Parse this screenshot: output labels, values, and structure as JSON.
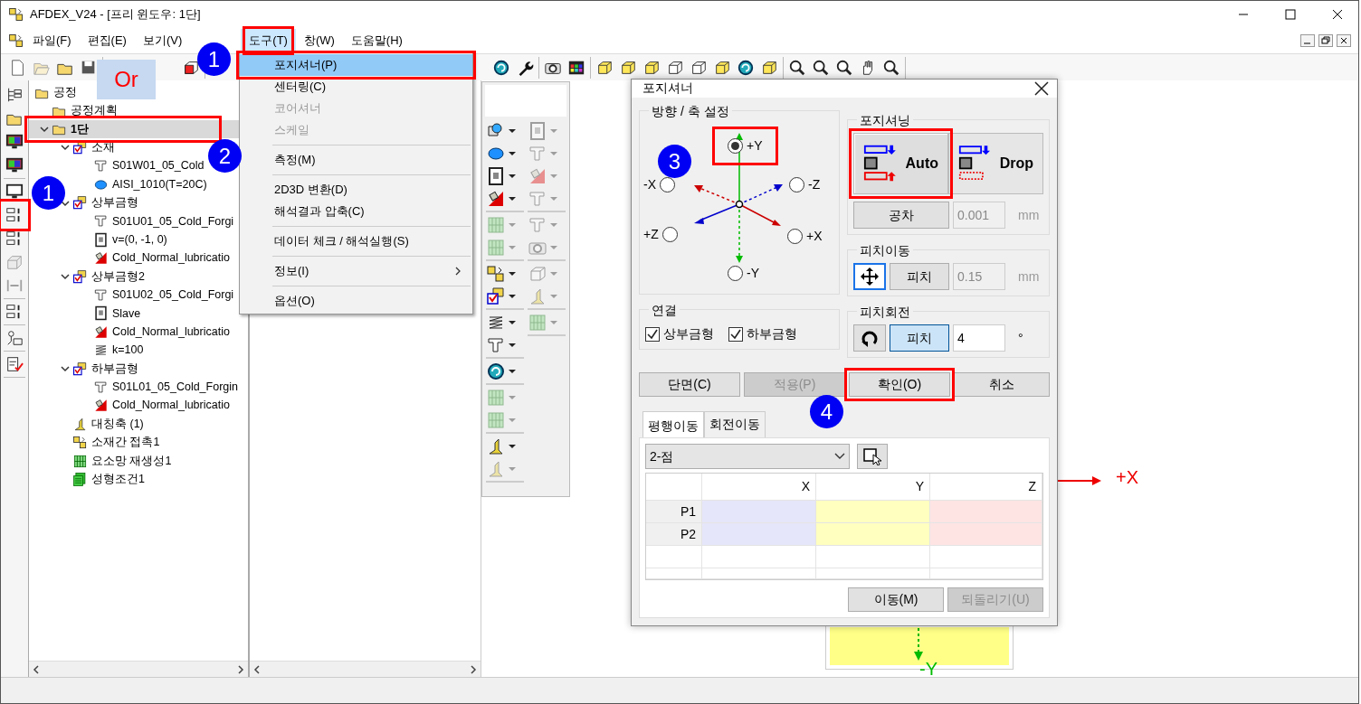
{
  "window": {
    "title": "AFDEX_V24 - [프리 윈도우: 1단]"
  },
  "menu_bar": [
    {
      "label": "파일(F)",
      "selected": false
    },
    {
      "label": "편집(E)",
      "selected": false
    },
    {
      "label": "보기(V)",
      "selected": false
    },
    {
      "label": "도구(T)",
      "selected": true
    },
    {
      "label": "창(W)",
      "selected": false
    },
    {
      "label": "도움말(H)",
      "selected": false
    }
  ],
  "toolbar": {
    "groups": [
      [
        {
          "disabled": false
        },
        {
          "disabled": true
        },
        {
          "disabled": false
        },
        {
          "disabled": false
        }
      ],
      [
        {
          "disabled": false
        }
      ],
      [
        {
          "disabled": false
        },
        {
          "disabled": false
        }
      ],
      [
        {
          "disabled": false
        },
        {
          "disabled": false
        }
      ],
      [
        {
          "disabled": false
        },
        {
          "disabled": false
        },
        {
          "disabled": false
        },
        {
          "disabled": false
        },
        {
          "disabled": false
        },
        {
          "disabled": false
        },
        {
          "disabled": false
        },
        {
          "disabled": false
        }
      ],
      [
        {
          "disabled": false
        },
        {
          "disabled": false
        },
        {
          "disabled": false
        },
        {
          "disabled": false
        },
        {
          "disabled": false
        }
      ]
    ]
  },
  "side_toolbar": {
    "groups": [
      [
        {
          "disabled": false
        },
        {
          "disabled": false
        },
        {
          "disabled": false
        },
        {
          "disabled": false
        }
      ],
      [
        {
          "disabled": false
        },
        {
          "disabled": false
        },
        {
          "disabled": false
        },
        {
          "disabled": true
        },
        {
          "disabled": true
        }
      ],
      [
        {
          "disabled": false
        }
      ],
      [
        {
          "disabled": false
        }
      ],
      [
        {
          "disabled": false
        }
      ]
    ]
  },
  "tree": [
    {
      "label": "공정",
      "kind": "folder",
      "children": [
        {
          "label": "공정계획",
          "kind": "folder"
        },
        {
          "label": "1단",
          "kind": "folder",
          "expanded": true,
          "selected": true,
          "children": [
            {
              "label": "소재",
              "kind": "group",
              "expanded": true,
              "children": [
                {
                  "label": "S01W01_05_Cold",
                  "kind": "item"
                },
                {
                  "label": "AISI_1010(T=20C)",
                  "kind": "material"
                }
              ]
            },
            {
              "label": "상부금형",
              "kind": "group",
              "expanded": true,
              "children": [
                {
                  "label": "S01U01_05_Cold_Forgi",
                  "kind": "item"
                },
                {
                  "label": "v=(0, -1, 0)",
                  "kind": "press"
                },
                {
                  "label": "Cold_Normal_lubricatio",
                  "kind": "lube"
                }
              ]
            },
            {
              "label": "상부금형2",
              "kind": "group",
              "expanded": true,
              "children": [
                {
                  "label": "S01U02_05_Cold_Forgi",
                  "kind": "item"
                },
                {
                  "label": "Slave",
                  "kind": "press"
                },
                {
                  "label": "Cold_Normal_lubricatio",
                  "kind": "lube"
                },
                {
                  "label": "k=100",
                  "kind": "spring"
                }
              ]
            },
            {
              "label": "하부금형",
              "kind": "group",
              "expanded": true,
              "children": [
                {
                  "label": "S01L01_05_Cold_Forgin",
                  "kind": "item"
                },
                {
                  "label": "Cold_Normal_lubricatio",
                  "kind": "lube"
                }
              ]
            },
            {
              "label": "대칭축 (1)",
              "kind": "symmetry"
            },
            {
              "label": "소재간 접촉1",
              "kind": "contact"
            },
            {
              "label": "요소망 재생성1",
              "kind": "mesh"
            },
            {
              "label": "성형조건1",
              "kind": "condition"
            }
          ]
        }
      ]
    }
  ],
  "tools_menu": [
    {
      "kind": "item",
      "label": "포지셔너(P)",
      "selected": true,
      "disabled": false
    },
    {
      "kind": "item",
      "label": "센터링(C)",
      "selected": false,
      "disabled": false
    },
    {
      "kind": "item",
      "label": "코어셔너",
      "selected": false,
      "disabled": true
    },
    {
      "kind": "item",
      "label": "스케일",
      "selected": false,
      "disabled": true
    },
    {
      "kind": "separator"
    },
    {
      "kind": "item",
      "label": "측정(M)",
      "selected": false,
      "disabled": false
    },
    {
      "kind": "separator"
    },
    {
      "kind": "item",
      "label": "2D3D 변환(D)",
      "selected": false,
      "disabled": false
    },
    {
      "kind": "item",
      "label": "해석결과 압축(C)",
      "selected": false,
      "disabled": false
    },
    {
      "kind": "separator"
    },
    {
      "kind": "item",
      "label": "데이터 체크 / 해석실행(S)",
      "selected": false,
      "disabled": false
    },
    {
      "kind": "separator"
    },
    {
      "kind": "item",
      "label": "정보(I)",
      "selected": false,
      "disabled": false,
      "submenu": true
    },
    {
      "kind": "separator"
    },
    {
      "kind": "item",
      "label": "옵션(O)",
      "selected": false,
      "disabled": false
    }
  ],
  "palette": {
    "columns": [
      [
        [
          {
            "disabled": false
          },
          {
            "disabled": false
          },
          {
            "disabled": false
          },
          {
            "disabled": false
          }
        ],
        [
          {
            "disabled": true
          },
          {
            "disabled": true
          }
        ],
        [
          {
            "disabled": false
          },
          {
            "disabled": false
          }
        ],
        [
          {
            "disabled": false
          },
          {
            "disabled": false
          }
        ],
        [
          {
            "disabled": false
          }
        ],
        [
          {
            "disabled": true
          },
          {
            "disabled": true
          }
        ],
        [
          {
            "disabled": false
          },
          {
            "disabled": true
          }
        ]
      ],
      [
        [
          {
            "disabled": true
          },
          {
            "disabled": true
          },
          {
            "disabled": true
          },
          {
            "disabled": true
          }
        ],
        [
          {
            "disabled": true
          },
          {
            "disabled": true
          }
        ],
        [
          {
            "disabled": true
          },
          {
            "disabled": true
          }
        ],
        [
          {
            "disabled": true
          }
        ]
      ]
    ]
  },
  "or_label": "Or",
  "annotations": [
    {
      "label": "1"
    },
    {
      "label": "1"
    },
    {
      "label": "2"
    },
    {
      "label": "3"
    },
    {
      "label": "4"
    }
  ],
  "canvas": {
    "x_axis_label": "+X",
    "y_axis_label": "-Y"
  },
  "dialog": {
    "title": "포지셔너",
    "direction": {
      "title": "방향 / 축 설정",
      "options": [
        {
          "label": "+Y",
          "selected": true
        },
        {
          "label": "-X",
          "selected": false
        },
        {
          "label": "-Z",
          "selected": false
        },
        {
          "label": "+Z",
          "selected": false
        },
        {
          "label": "+X",
          "selected": false
        },
        {
          "label": "-Y",
          "selected": false
        }
      ]
    },
    "positioning": {
      "title": "포지셔닝",
      "modes": [
        {
          "label": "Auto",
          "kind": "auto",
          "selected": true
        },
        {
          "label": "Drop",
          "kind": "drop",
          "selected": false
        }
      ],
      "tolerance": {
        "button": "공차",
        "value": "0.001",
        "disabled": true,
        "unit": "mm"
      }
    },
    "pitch_move": {
      "title": "피치이동",
      "icon_selected": true,
      "button": "피치",
      "button_selected": false,
      "value": "0.15",
      "disabled": true,
      "unit": "mm"
    },
    "pitch_rotate": {
      "title": "피치회전",
      "icon_selected": false,
      "button": "피치",
      "button_selected": true,
      "value": "4",
      "disabled": false,
      "unit": "°"
    },
    "connection": {
      "title": "연결",
      "options": [
        {
          "label": "상부금형",
          "checked": true
        },
        {
          "label": "하부금형",
          "checked": true
        }
      ]
    },
    "actions": [
      {
        "label": "단면(C)",
        "disabled": false
      },
      {
        "label": "적용(P)",
        "disabled": true
      },
      {
        "label": "확인(O)",
        "disabled": false
      },
      {
        "label": "취소",
        "disabled": false
      }
    ],
    "tabs": [
      {
        "label": "평행이동",
        "selected": true
      },
      {
        "label": "회전이동",
        "selected": false
      }
    ],
    "method": {
      "value": "2-점"
    },
    "grid": {
      "columns": [
        {
          "label": "X",
          "color": "#e6e6fa"
        },
        {
          "label": "Y",
          "color": "#ffffc0"
        },
        {
          "label": "Z",
          "color": "#ffe4e4"
        }
      ],
      "rows": [
        {
          "label": "P1"
        },
        {
          "label": "P2"
        }
      ]
    },
    "footer_buttons": [
      {
        "label": "이동(M)",
        "disabled": false
      },
      {
        "label": "되돌리기(U)",
        "disabled": true
      }
    ]
  }
}
